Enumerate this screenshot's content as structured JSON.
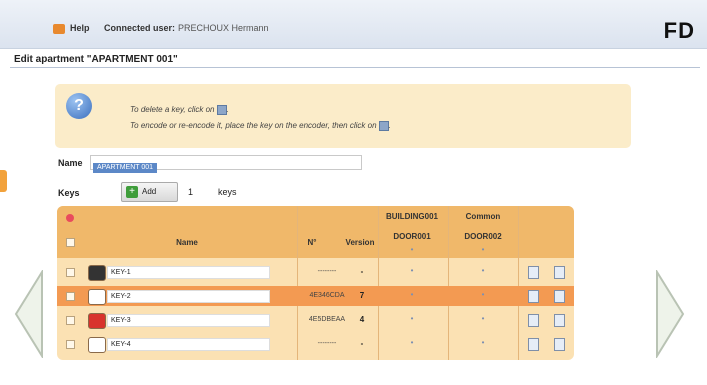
{
  "header": {
    "help_label": "Help",
    "connected_label": "Connected user:",
    "user_name": "PRECHOUX Hermann",
    "logo_text": "FD"
  },
  "page": {
    "title": "Edit apartment \"APARTMENT 001\""
  },
  "info": {
    "line1": "To delete a key, click on",
    "line2": "To encode or re-encode it, place the key on the encoder, then click on",
    "icon_text": "?"
  },
  "form": {
    "name_label": "Name",
    "name_value": "APARTMENT 001",
    "keys_label": "Keys",
    "add_label": "Add",
    "add_qty": "1",
    "keys_unit": "keys"
  },
  "table": {
    "headers": {
      "name": "Name",
      "number": "N°",
      "version": "Version",
      "door1_top": "BUILDING001",
      "door1_bottom": "DOOR001",
      "door2_top": "Common",
      "door2_bottom": "DOOR002"
    },
    "rows": [
      {
        "name": "KEY-1",
        "serial": "--------",
        "version": "-",
        "selected": false,
        "icon_color": "#333333"
      },
      {
        "name": "KEY-2",
        "serial": "4E346CDA",
        "version": "7",
        "selected": true,
        "icon_color": "#ffffff"
      },
      {
        "name": "KEY-3",
        "serial": "4E5DBEAA",
        "version": "4",
        "selected": false,
        "icon_color": "#d8332d"
      },
      {
        "name": "KEY-4",
        "serial": "--------",
        "version": "-",
        "selected": false,
        "icon_color": "#ffffff"
      }
    ],
    "door_marker": "•"
  },
  "colors": {
    "accent_orange": "#f39a52",
    "panel": "#fbe1b3",
    "info_bg": "#fbecc9"
  }
}
